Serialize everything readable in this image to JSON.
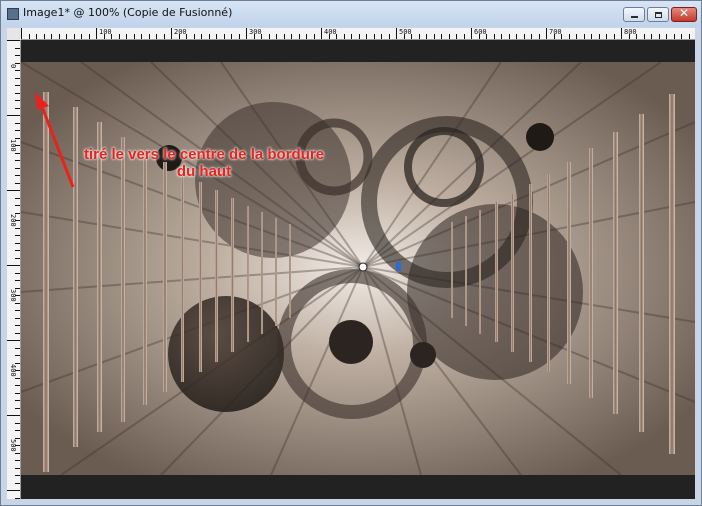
{
  "window": {
    "title": "Image1* @ 100% (Copie de Fusionné)",
    "buttons": {
      "minimize": "minimize",
      "maximize": "maximize",
      "close": "✕"
    }
  },
  "rulers": {
    "top_labels": [
      "100",
      "200",
      "300",
      "400",
      "500",
      "600",
      "700",
      "800"
    ],
    "left_labels": [
      "0",
      "100",
      "200",
      "300",
      "400",
      "500"
    ]
  },
  "canvas": {
    "annotation_text": "tiré le vers le centre de la bordure du haut"
  },
  "colors": {
    "annotation": "#e8221c",
    "titlebar": "#c7d5e6"
  },
  "icons": [
    "app-icon",
    "minimize-icon",
    "maximize-icon",
    "close-icon",
    "red-arrow-icon"
  ]
}
